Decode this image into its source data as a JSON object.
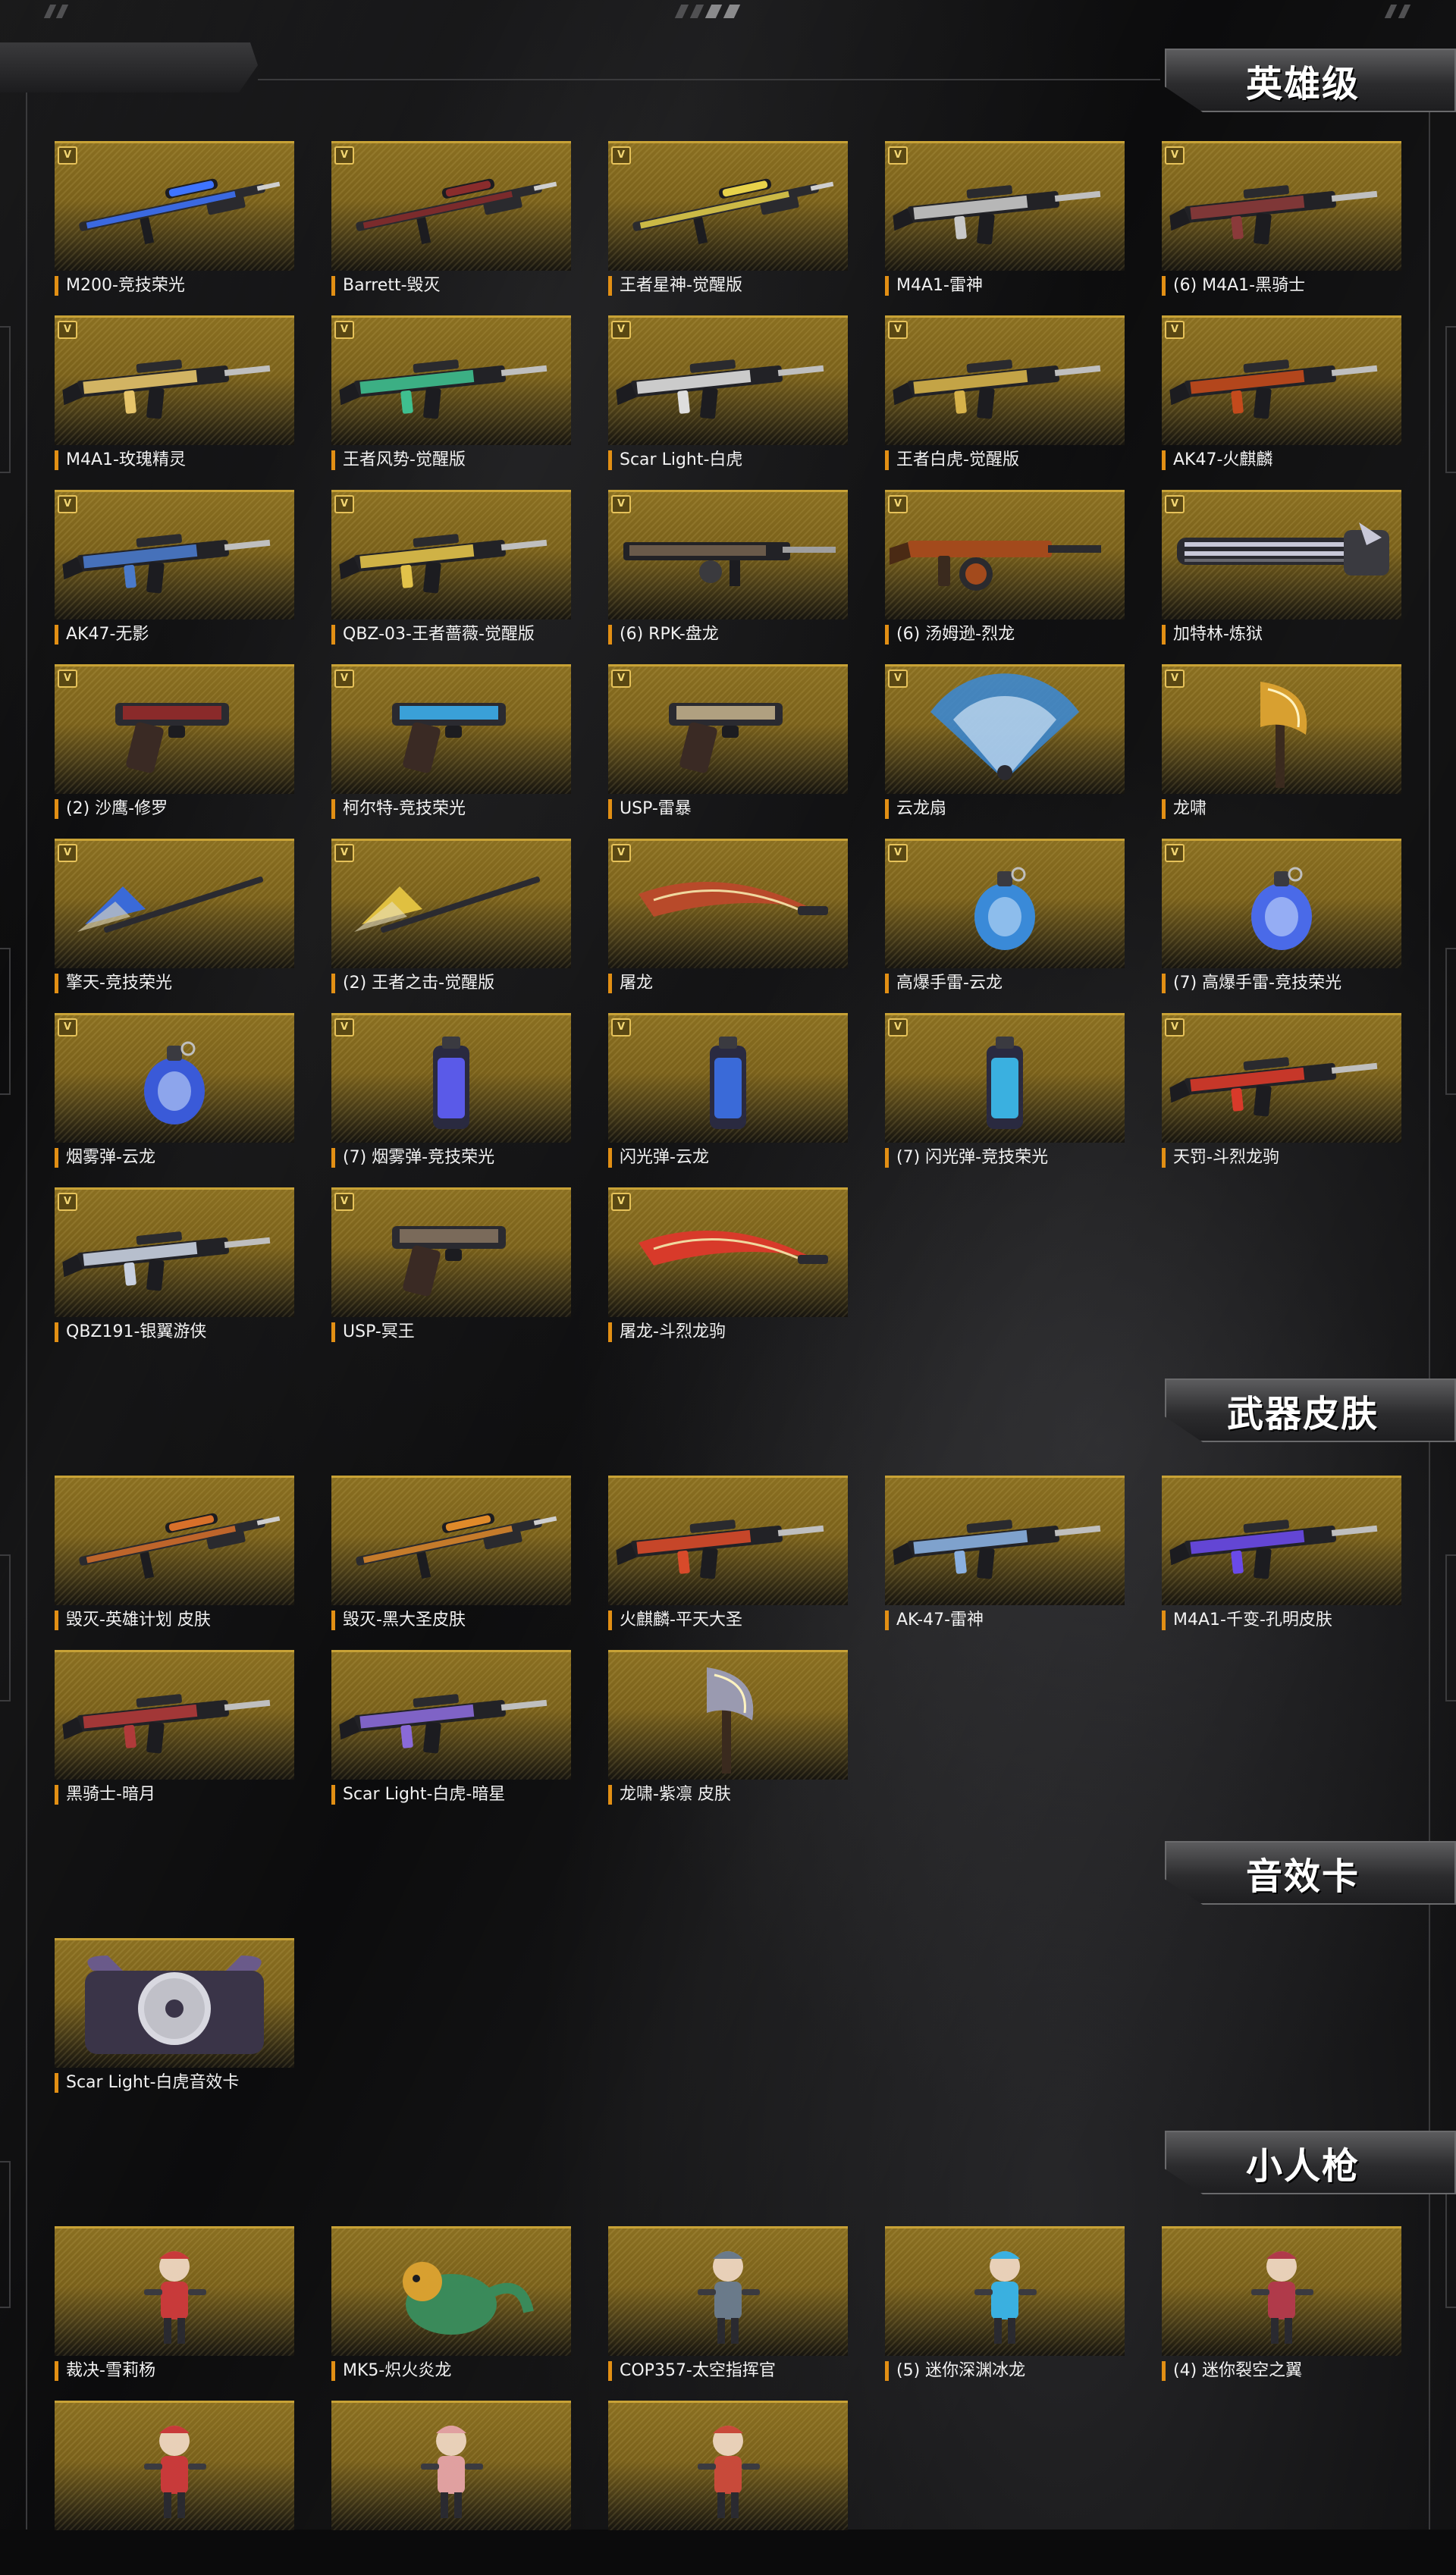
{
  "sections": [
    {
      "title": "英雄级",
      "items": [
        {
          "label": "M200-竞技荣光",
          "icon": "sniper-rifle-icon",
          "badge": "V",
          "accent": "#3e74ff"
        },
        {
          "label": "Barrett-毁灭",
          "icon": "sniper-rifle-icon",
          "badge": "V",
          "accent": "#8a2c2c"
        },
        {
          "label": "王者星神-觉醒版",
          "icon": "sniper-rifle-icon",
          "badge": "V",
          "accent": "#e8d24a"
        },
        {
          "label": "M4A1-雷神",
          "icon": "assault-rifle-icon",
          "badge": "V",
          "accent": "#c8c8c8"
        },
        {
          "label": "(6) M4A1-黑骑士",
          "icon": "assault-rifle-icon",
          "badge": "V",
          "accent": "#8a3a3a"
        },
        {
          "label": "M4A1-玫瑰精灵",
          "icon": "assault-rifle-icon",
          "badge": "V",
          "accent": "#e6c46a"
        },
        {
          "label": "王者风势-觉醒版",
          "icon": "assault-rifle-icon",
          "badge": "V",
          "accent": "#3fbf8f"
        },
        {
          "label": "Scar Light-白虎",
          "icon": "assault-rifle-icon",
          "badge": "V",
          "accent": "#dedede"
        },
        {
          "label": "王者白虎-觉醒版",
          "icon": "assault-rifle-icon",
          "badge": "V",
          "accent": "#d6b24a"
        },
        {
          "label": "AK47-火麒麟",
          "icon": "assault-rifle-icon",
          "badge": "V",
          "accent": "#c34a1c"
        },
        {
          "label": "AK47-无影",
          "icon": "assault-rifle-icon",
          "badge": "V",
          "accent": "#4a7acb"
        },
        {
          "label": "QBZ-03-王者蔷薇-觉醒版",
          "icon": "assault-rifle-icon",
          "badge": "V",
          "accent": "#e2c24a"
        },
        {
          "label": "(6) RPK-盘龙",
          "icon": "machine-gun-icon",
          "badge": "V",
          "accent": "#6a5a4a"
        },
        {
          "label": "(6) 汤姆逊-烈龙",
          "icon": "submachine-gun-icon",
          "badge": "V",
          "accent": "#a34a1c"
        },
        {
          "label": "加特林-炼狱",
          "icon": "gatling-gun-icon",
          "badge": "V",
          "accent": "#c8c8d8"
        },
        {
          "label": "(2) 沙鹰-修罗",
          "icon": "pistol-icon",
          "badge": "V",
          "accent": "#8a2a2a"
        },
        {
          "label": "柯尔特-竞技荣光",
          "icon": "pistol-icon",
          "badge": "V",
          "accent": "#3aa0d8"
        },
        {
          "label": "USP-雷暴",
          "icon": "pistol-icon",
          "badge": "V",
          "accent": "#b0a080"
        },
        {
          "label": "云龙扇",
          "icon": "fan-icon",
          "badge": "V",
          "accent": "#3a8ad8"
        },
        {
          "label": "龙啸",
          "icon": "axe-icon",
          "badge": "V",
          "accent": "#d8a030"
        },
        {
          "label": "擎天-竞技荣光",
          "icon": "spear-icon",
          "badge": "V",
          "accent": "#3a6ad8"
        },
        {
          "label": "(2) 王者之击-觉醒版",
          "icon": "spear-icon",
          "badge": "V",
          "accent": "#e0c040"
        },
        {
          "label": "屠龙",
          "icon": "blade-icon",
          "badge": "V",
          "accent": "#b84a2a"
        },
        {
          "label": "高爆手雷-云龙",
          "icon": "grenade-icon",
          "badge": "V",
          "accent": "#3a8ad8"
        },
        {
          "label": "(7) 高爆手雷-竞技荣光",
          "icon": "grenade-icon",
          "badge": "V",
          "accent": "#4a6ae8"
        },
        {
          "label": "烟雾弹-云龙",
          "icon": "grenade-icon",
          "badge": "V",
          "accent": "#3a5ad8"
        },
        {
          "label": "(7) 烟雾弹-竞技荣光",
          "icon": "canister-icon",
          "badge": "V",
          "accent": "#5a5ae8"
        },
        {
          "label": "闪光弹-云龙",
          "icon": "canister-icon",
          "badge": "V",
          "accent": "#3a6ad8"
        },
        {
          "label": "(7) 闪光弹-竞技荣光",
          "icon": "canister-icon",
          "badge": "V",
          "accent": "#3ab0e0"
        },
        {
          "label": "天罚-斗烈龙驹",
          "icon": "assault-rifle-icon",
          "badge": "V",
          "accent": "#d83a2a"
        },
        {
          "label": "QBZ191-银翼游侠",
          "icon": "assault-rifle-icon",
          "badge": "V",
          "accent": "#c8d0e0"
        },
        {
          "label": "USP-冥王",
          "icon": "pistol-icon",
          "badge": "V",
          "accent": "#7a6a5a"
        },
        {
          "label": "屠龙-斗烈龙驹",
          "icon": "blade-icon",
          "badge": "V",
          "accent": "#d83a2a"
        }
      ]
    },
    {
      "title": "武器皮肤",
      "items": [
        {
          "label": "毁灭-英雄计划 皮肤",
          "icon": "sniper-rifle-icon",
          "badge": "",
          "accent": "#d8702a"
        },
        {
          "label": "毁灭-黑大圣皮肤",
          "icon": "sniper-rifle-icon",
          "badge": "",
          "accent": "#e08a2a"
        },
        {
          "label": "火麒麟-平天大圣",
          "icon": "assault-rifle-icon",
          "badge": "",
          "accent": "#d84a2a"
        },
        {
          "label": "AK-47-雷神",
          "icon": "assault-rifle-icon",
          "badge": "",
          "accent": "#8ab0e0"
        },
        {
          "label": "M4A1-千变-孔明皮肤",
          "icon": "assault-rifle-icon",
          "badge": "",
          "accent": "#6a4ae8"
        },
        {
          "label": "黑骑士-暗月",
          "icon": "assault-rifle-icon",
          "badge": "",
          "accent": "#b03a3a"
        },
        {
          "label": "Scar Light-白虎-暗星",
          "icon": "assault-rifle-icon",
          "badge": "",
          "accent": "#8a6ad8"
        },
        {
          "label": "龙啸-紫凛 皮肤",
          "icon": "axe-icon",
          "badge": "",
          "accent": "#9a9ab0"
        }
      ]
    },
    {
      "title": "音效卡",
      "items": [
        {
          "label": "Scar Light-白虎音效卡",
          "icon": "disc-icon",
          "badge": "",
          "accent": "#c0c0c8"
        }
      ]
    },
    {
      "title": "小人枪",
      "items": [
        {
          "label": "裁决-雪莉杨",
          "icon": "chibi-figure-icon",
          "badge": "",
          "accent": "#c83a3a"
        },
        {
          "label": "MK5-炽火炎龙",
          "icon": "dragon-icon",
          "badge": "",
          "accent": "#d8a030"
        },
        {
          "label": "COP357-太空指挥官",
          "icon": "chibi-figure-icon",
          "badge": "",
          "accent": "#6a7a8a"
        },
        {
          "label": "(5) 迷你深渊冰龙",
          "icon": "chibi-figure-icon",
          "badge": "",
          "accent": "#3ab0e0"
        },
        {
          "label": "(4) 迷你裂空之翼",
          "icon": "chibi-figure-icon",
          "badge": "",
          "accent": "#b03a4a"
        },
        {
          "label": "",
          "icon": "chibi-figure-icon",
          "badge": "",
          "accent": "#c83a3a"
        },
        {
          "label": "",
          "icon": "chibi-figure-icon",
          "badge": "",
          "accent": "#e0a0a0"
        },
        {
          "label": "",
          "icon": "chibi-figure-icon",
          "badge": "",
          "accent": "#c84a3a"
        }
      ]
    }
  ]
}
